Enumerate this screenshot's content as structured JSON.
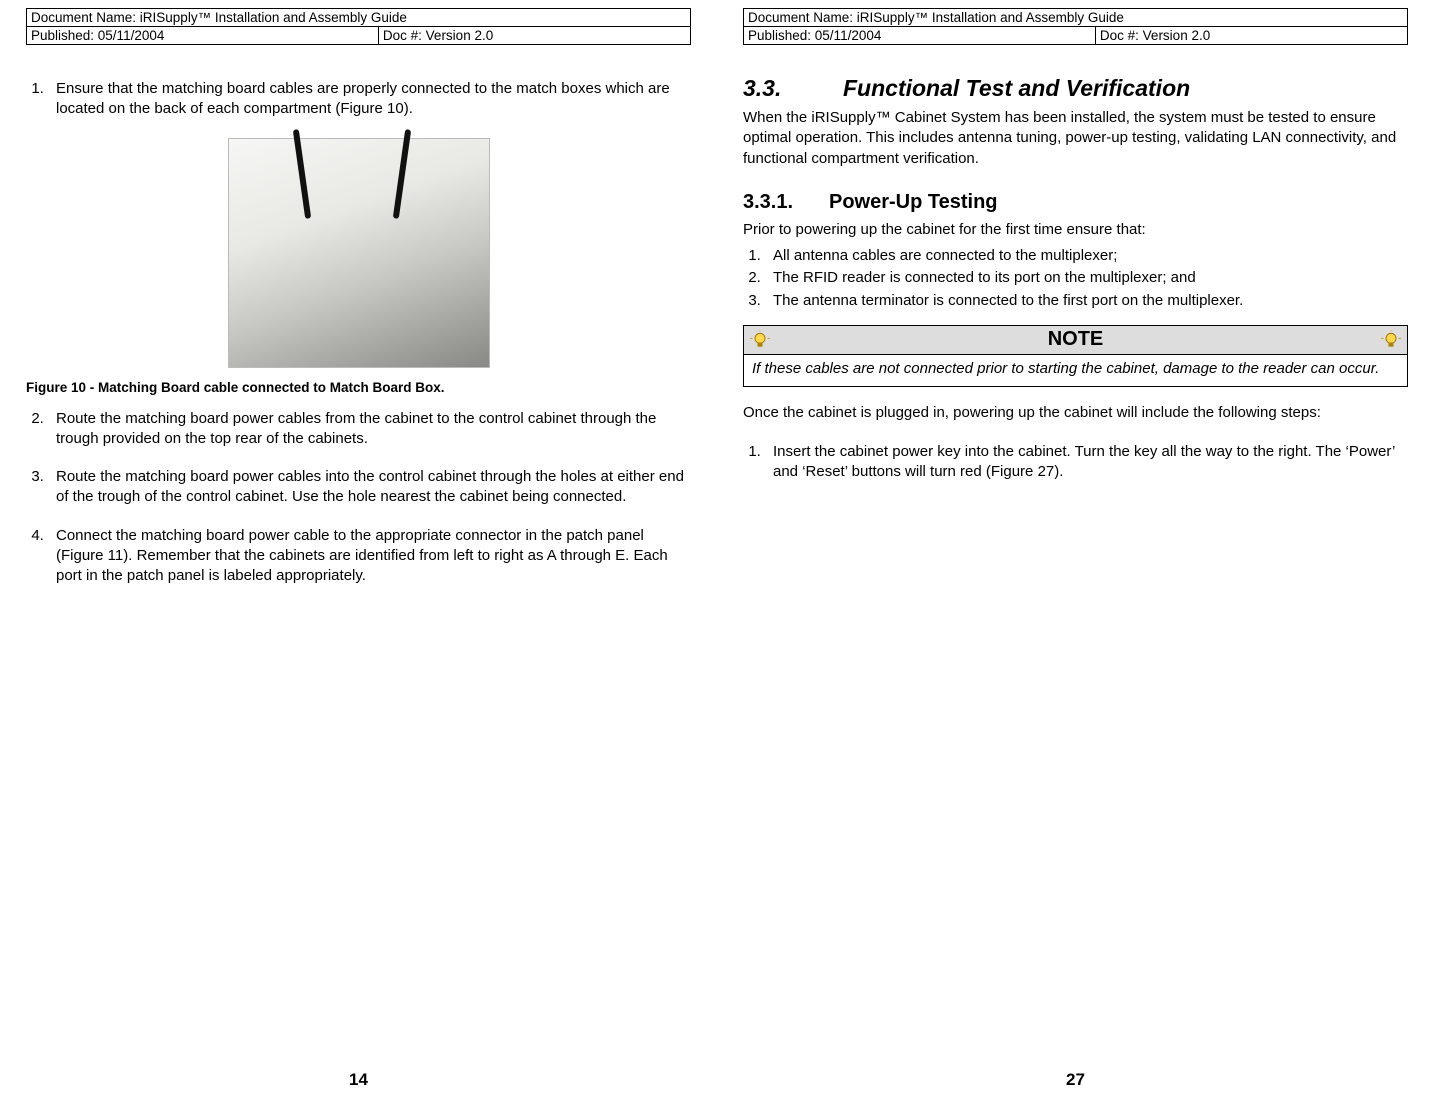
{
  "left": {
    "header": {
      "docName": "Document Name:  iRISupply™ Installation and Assembly Guide",
      "published": "Published:  05/11/2004",
      "doc": "Doc #:  Version 2.0"
    },
    "items": [
      "Ensure that the matching board cables are properly connected to the match boxes which are located on the back of each compartment (Figure 10).",
      "Route the matching board power cables from the cabinet to the control cabinet through the trough provided on the top rear of the cabinets.",
      "Route the matching board power cables into the control cabinet through the holes at either end of the trough of the control cabinet.  Use the hole nearest the cabinet being connected.",
      "Connect the matching board power cable to the appropriate connector in the patch panel (Figure 11).  Remember that the cabinets are identified from left to right as A through E.  Each port in the patch panel is labeled appropriately."
    ],
    "figCaption": "Figure 10 - Matching Board cable connected to Match Board Box.",
    "pageNum": "14"
  },
  "right": {
    "header": {
      "docName": "Document Name:  iRISupply™ Installation and Assembly Guide",
      "published": "Published:  05/11/2004",
      "doc": "Doc #:  Version 2.0"
    },
    "h2": {
      "num": "3.3.",
      "title": "Functional Test and Verification"
    },
    "p1": "When the iRISupply™ Cabinet System has been installed, the system must be tested to ensure optimal operation.  This includes antenna tuning, power-up testing, validating LAN connectivity, and functional compartment verification.",
    "h3": {
      "num": "3.3.1.",
      "title": "Power-Up Testing"
    },
    "p2": "Prior to powering up the cabinet for the first time ensure that:",
    "preList": [
      "All antenna cables are connected to the multiplexer;",
      "The RFID reader is connected to its port on the multiplexer; and",
      "The antenna terminator is connected to the first port on the multiplexer."
    ],
    "noteTitle": "NOTE",
    "noteBody": "If these cables are not connected prior to starting the cabinet, damage to the reader can occur.",
    "p3": "Once the cabinet is plugged in, powering up the cabinet will include the following steps:",
    "stepList": [
      "Insert the cabinet power key into the cabinet.  Turn the key all the way to the right.  The ‘Power’ and ‘Reset’ buttons will turn red (Figure 27)."
    ],
    "pageNum": "27"
  }
}
